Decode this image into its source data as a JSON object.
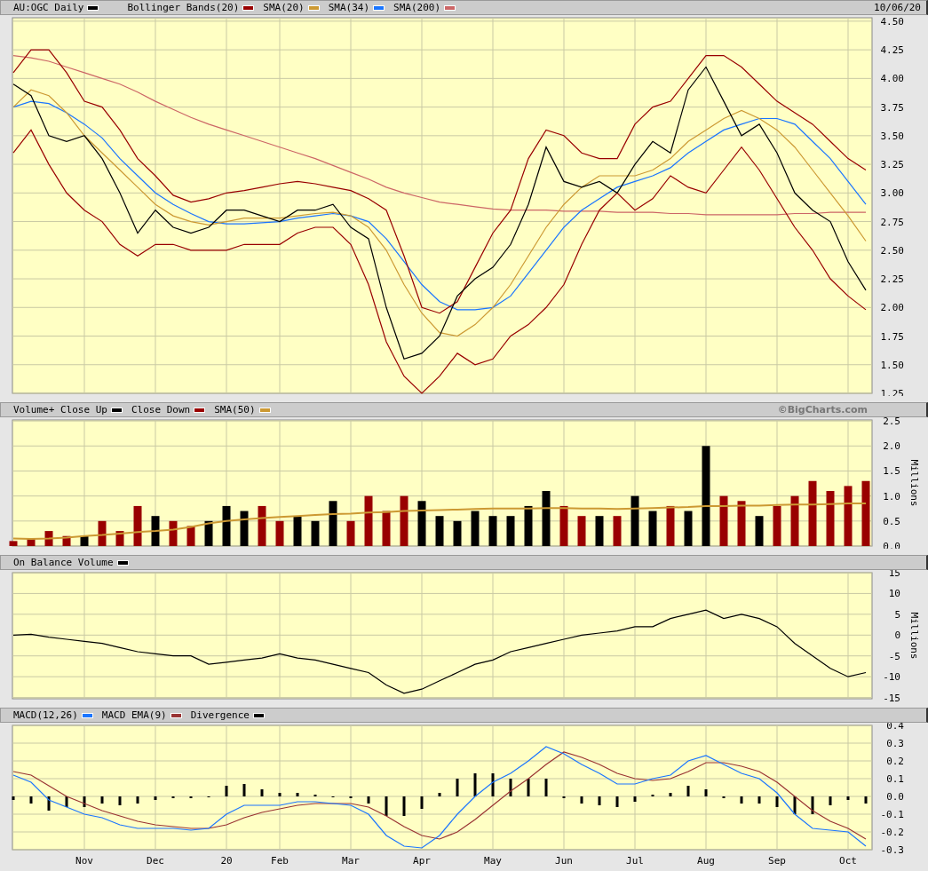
{
  "panels": [
    {
      "date": "10/06/20",
      "chart_data": {
        "type": "line",
        "grid": true,
        "categories": [
          null,
          null,
          null,
          null,
          null,
          null,
          null,
          null,
          null,
          null,
          null,
          null,
          null,
          null,
          null,
          null,
          null,
          null,
          null,
          null,
          null,
          null,
          null,
          null,
          null,
          null,
          null,
          null,
          null,
          null,
          null,
          null,
          null,
          null,
          null,
          null,
          null,
          null,
          null,
          null,
          null,
          null,
          null,
          null,
          null,
          null,
          null,
          null,
          null
        ],
        "ylim": [
          1.25,
          4.53
        ],
        "yticks": [
          {
            "value": 4.5,
            "label": "4.50"
          },
          {
            "value": 4.25,
            "label": "4.25"
          },
          {
            "value": 4,
            "label": "4.00"
          },
          {
            "value": 3.75,
            "label": "3.75"
          },
          {
            "value": 3.5,
            "label": "3.50"
          },
          {
            "value": 3.25,
            "label": "3.25"
          },
          {
            "value": 3,
            "label": "3.00"
          },
          {
            "value": 2.75,
            "label": "2.75"
          },
          {
            "value": 2.5,
            "label": "2.50"
          },
          {
            "value": 2.25,
            "label": "2.25"
          },
          {
            "value": 2,
            "label": "2.00"
          },
          {
            "value": 1.75,
            "label": "1.75"
          },
          {
            "value": 1.5,
            "label": "1.50"
          },
          {
            "value": 1.25,
            "label": "1.25"
          }
        ],
        "series": [
          {
            "name": "AU:OGC Daily",
            "color": "#000000",
            "values": [
              3.95,
              3.85,
              3.5,
              3.45,
              3.5,
              3.3,
              3.0,
              2.65,
              2.85,
              2.7,
              2.65,
              2.7,
              2.85,
              2.85,
              2.8,
              2.75,
              2.85,
              2.85,
              2.9,
              2.7,
              2.6,
              2.0,
              1.55,
              1.6,
              1.75,
              2.1,
              2.25,
              2.35,
              2.55,
              2.9,
              3.4,
              3.1,
              3.05,
              3.1,
              3.0,
              3.25,
              3.45,
              3.35,
              3.9,
              4.1,
              3.8,
              3.5,
              3.6,
              3.35,
              3.0,
              2.85,
              2.75,
              2.4,
              2.15
            ]
          },
          {
            "name": "Bollinger Bands(20)",
            "color": "#990000",
            "values": [
              4.05,
              4.25,
              4.25,
              4.05,
              3.8,
              3.75,
              3.55,
              3.3,
              3.15,
              2.98,
              2.92,
              2.95,
              3.0,
              3.02,
              3.05,
              3.08,
              3.1,
              3.08,
              3.05,
              3.02,
              2.95,
              2.85,
              2.45,
              2.0,
              1.95,
              2.05,
              2.35,
              2.65,
              2.85,
              3.3,
              3.55,
              3.5,
              3.35,
              3.3,
              3.3,
              3.6,
              3.75,
              3.8,
              4.0,
              4.2,
              4.2,
              4.1,
              3.95,
              3.8,
              3.7,
              3.6,
              3.45,
              3.3,
              3.2
            ]
          },
          {
            "color": "#990000",
            "values": [
              3.35,
              3.55,
              3.25,
              3.0,
              2.85,
              2.75,
              2.55,
              2.45,
              2.55,
              2.55,
              2.5,
              2.5,
              2.5,
              2.55,
              2.55,
              2.55,
              2.65,
              2.7,
              2.7,
              2.55,
              2.2,
              1.7,
              1.4,
              1.25,
              1.4,
              1.6,
              1.5,
              1.55,
              1.75,
              1.85,
              2.0,
              2.2,
              2.55,
              2.85,
              3.0,
              2.85,
              2.95,
              3.15,
              3.05,
              3.0,
              3.2,
              3.4,
              3.2,
              2.95,
              2.7,
              2.5,
              2.25,
              2.1,
              1.98
            ]
          },
          {
            "name": "SMA(20)",
            "color": "#cc9933",
            "values": [
              3.75,
              3.9,
              3.85,
              3.7,
              3.5,
              3.35,
              3.2,
              3.05,
              2.9,
              2.8,
              2.75,
              2.72,
              2.75,
              2.78,
              2.78,
              2.78,
              2.8,
              2.82,
              2.83,
              2.8,
              2.7,
              2.5,
              2.2,
              1.95,
              1.78,
              1.75,
              1.85,
              2.0,
              2.2,
              2.45,
              2.7,
              2.9,
              3.05,
              3.15,
              3.15,
              3.15,
              3.2,
              3.3,
              3.45,
              3.55,
              3.65,
              3.72,
              3.65,
              3.55,
              3.4,
              3.2,
              3.0,
              2.8,
              2.58
            ]
          },
          {
            "name": "SMA(34)",
            "color": "#1a75ff",
            "values": [
              3.75,
              3.8,
              3.78,
              3.7,
              3.6,
              3.48,
              3.3,
              3.15,
              3.0,
              2.9,
              2.82,
              2.75,
              2.73,
              2.73,
              2.74,
              2.75,
              2.78,
              2.8,
              2.82,
              2.8,
              2.75,
              2.6,
              2.4,
              2.2,
              2.05,
              1.98,
              1.98,
              2.0,
              2.1,
              2.3,
              2.5,
              2.7,
              2.85,
              2.95,
              3.05,
              3.1,
              3.15,
              3.22,
              3.35,
              3.45,
              3.55,
              3.6,
              3.65,
              3.65,
              3.6,
              3.45,
              3.3,
              3.1,
              2.9
            ]
          },
          {
            "name": "SMA(200)",
            "color": "#cc6666",
            "values": [
              4.2,
              4.18,
              4.15,
              4.1,
              4.05,
              4.0,
              3.95,
              3.88,
              3.8,
              3.73,
              3.66,
              3.6,
              3.55,
              3.5,
              3.45,
              3.4,
              3.35,
              3.3,
              3.24,
              3.18,
              3.12,
              3.05,
              3.0,
              2.96,
              2.92,
              2.9,
              2.88,
              2.86,
              2.85,
              2.85,
              2.85,
              2.84,
              2.84,
              2.84,
              2.83,
              2.83,
              2.83,
              2.82,
              2.82,
              2.81,
              2.81,
              2.81,
              2.81,
              2.81,
              2.82,
              2.82,
              2.83,
              2.83,
              2.83
            ]
          }
        ]
      }
    },
    {
      "credit": "©BigCharts.com",
      "axis_title": "Millions",
      "chart_data": {
        "type": "bar",
        "grid": true,
        "categories": [
          null,
          null,
          null,
          null,
          null,
          null,
          null,
          null,
          null,
          null,
          null,
          null,
          null,
          null,
          null,
          null,
          null,
          null,
          null,
          null,
          null,
          null,
          null,
          null,
          null,
          null,
          null,
          null,
          null,
          null,
          null,
          null,
          null,
          null,
          null,
          null,
          null,
          null,
          null,
          null,
          null,
          null,
          null,
          null,
          null,
          null,
          null,
          null,
          null
        ],
        "ylim": [
          0,
          2.52
        ],
        "yticks": [
          {
            "value": 2.5,
            "label": "2.5"
          },
          {
            "value": 2,
            "label": "2.0"
          },
          {
            "value": 1.5,
            "label": "1.5"
          },
          {
            "value": 1,
            "label": "1.0"
          },
          {
            "value": 0.5,
            "label": "0.5"
          },
          {
            "value": 0,
            "label": "0.0"
          }
        ],
        "series": [
          {
            "name": "Volume+ Close Up",
            "color": "#000000",
            "type": "bar",
            "values": [
              null,
              null,
              null,
              null,
              0.2,
              null,
              null,
              null,
              0.6,
              null,
              null,
              0.5,
              0.8,
              0.7,
              null,
              null,
              0.6,
              0.5,
              0.9,
              null,
              null,
              null,
              null,
              0.9,
              0.6,
              0.5,
              0.7,
              0.6,
              0.6,
              0.8,
              1.1,
              null,
              null,
              0.6,
              null,
              1.0,
              0.7,
              null,
              0.7,
              2.0,
              null,
              null,
              0.6,
              null,
              null,
              null,
              null,
              null,
              null
            ]
          },
          {
            "name": "Close Down",
            "color": "#990000",
            "type": "bar",
            "values": [
              0.1,
              0.15,
              0.3,
              0.2,
              null,
              0.5,
              0.3,
              0.8,
              null,
              0.5,
              0.4,
              null,
              null,
              null,
              0.8,
              0.5,
              null,
              null,
              null,
              0.5,
              1.0,
              0.7,
              1.0,
              null,
              null,
              null,
              null,
              null,
              null,
              null,
              null,
              0.8,
              0.6,
              null,
              0.6,
              null,
              null,
              0.8,
              null,
              null,
              1.0,
              0.9,
              null,
              0.8,
              1.0,
              1.3,
              1.1,
              1.2,
              1.3
            ]
          },
          {
            "name": "SMA(50)",
            "color": "#cc9933",
            "type": "line",
            "values": [
              0.15,
              0.14,
              0.15,
              0.17,
              0.2,
              0.22,
              0.25,
              0.28,
              0.3,
              0.33,
              0.38,
              0.45,
              0.5,
              0.53,
              0.56,
              0.58,
              0.6,
              0.62,
              0.64,
              0.65,
              0.67,
              0.68,
              0.7,
              0.71,
              0.72,
              0.73,
              0.74,
              0.75,
              0.75,
              0.75,
              0.76,
              0.76,
              0.75,
              0.75,
              0.74,
              0.75,
              0.76,
              0.77,
              0.78,
              0.8,
              0.8,
              0.81,
              0.81,
              0.82,
              0.83,
              0.83,
              0.84,
              0.85,
              0.85
            ]
          }
        ]
      }
    },
    {
      "axis_title": "Millions",
      "chart_data": {
        "type": "line",
        "grid": true,
        "categories": [
          null,
          null,
          null,
          null,
          null,
          null,
          null,
          null,
          null,
          null,
          null,
          null,
          null,
          null,
          null,
          null,
          null,
          null,
          null,
          null,
          null,
          null,
          null,
          null,
          null,
          null,
          null,
          null,
          null,
          null,
          null,
          null,
          null,
          null,
          null,
          null,
          null,
          null,
          null,
          null,
          null,
          null,
          null,
          null,
          null,
          null,
          null,
          null,
          null
        ],
        "ylim": [
          -15.3,
          15
        ],
        "yticks": [
          {
            "value": 15,
            "label": "15"
          },
          {
            "value": 10,
            "label": "10"
          },
          {
            "value": 5,
            "label": "5"
          },
          {
            "value": 0,
            "label": "0"
          },
          {
            "value": -5,
            "label": "-5"
          },
          {
            "value": -10,
            "label": "-10"
          },
          {
            "value": -15,
            "label": "-15"
          }
        ],
        "series": [
          {
            "name": "On Balance Volume",
            "color": "#000000",
            "values": [
              0,
              0.2,
              -0.5,
              -1,
              -1.5,
              -2,
              -3,
              -4,
              -4.5,
              -5,
              -5,
              -7,
              -6.5,
              -6,
              -5.5,
              -4.5,
              -5.5,
              -6,
              -7,
              -8,
              -9,
              -12,
              -14,
              -13,
              -11,
              -9,
              -7,
              -6,
              -4,
              -3,
              -2,
              -1,
              0,
              0.5,
              1,
              2,
              2,
              4,
              5,
              6,
              4,
              5,
              4,
              2,
              -2,
              -5,
              -8,
              -10,
              -9
            ]
          }
        ]
      }
    },
    {
      "chart_data": {
        "type": "line",
        "categories": [
          null,
          null,
          null,
          null,
          "Nov",
          null,
          null,
          null,
          "Dec",
          null,
          null,
          null,
          "20",
          null,
          null,
          "Feb",
          null,
          null,
          null,
          "Mar",
          null,
          null,
          null,
          "Apr",
          null,
          null,
          null,
          "May",
          null,
          null,
          null,
          "Jun",
          null,
          null,
          null,
          "Jul",
          null,
          null,
          null,
          "Aug",
          null,
          null,
          null,
          "Sep",
          null,
          null,
          null,
          "Oct",
          null
        ],
        "grid": true,
        "ylim": [
          -0.3,
          0.4
        ],
        "yticks": [
          {
            "value": 0.4,
            "label": "0.4"
          },
          {
            "value": 0.3,
            "label": "0.3"
          },
          {
            "value": 0.2,
            "label": "0.2"
          },
          {
            "value": 0.1,
            "label": "0.1"
          },
          {
            "value": 0,
            "label": "0.0"
          },
          {
            "value": -0.1,
            "label": "-0.1"
          },
          {
            "value": -0.2,
            "label": "-0.2"
          },
          {
            "value": -0.3,
            "label": "-0.3"
          }
        ],
        "series": [
          {
            "name": "MACD(12,26)",
            "color": "#1a75ff",
            "type": "line",
            "values": [
              0.12,
              0.08,
              -0.02,
              -0.06,
              -0.1,
              -0.12,
              -0.16,
              -0.18,
              -0.18,
              -0.18,
              -0.19,
              -0.18,
              -0.1,
              -0.05,
              -0.05,
              -0.05,
              -0.03,
              -0.03,
              -0.04,
              -0.05,
              -0.1,
              -0.22,
              -0.28,
              -0.29,
              -0.22,
              -0.1,
              0,
              0.08,
              0.13,
              0.2,
              0.28,
              0.24,
              0.18,
              0.13,
              0.07,
              0.07,
              0.1,
              0.12,
              0.2,
              0.23,
              0.18,
              0.13,
              0.1,
              0.02,
              -0.1,
              -0.18,
              -0.19,
              -0.2,
              -0.28
            ]
          },
          {
            "name": "MACD EMA(9)",
            "color": "#993333",
            "type": "line",
            "values": [
              0.14,
              0.12,
              0.06,
              0,
              -0.04,
              -0.08,
              -0.11,
              -0.14,
              -0.16,
              -0.17,
              -0.18,
              -0.18,
              -0.16,
              -0.12,
              -0.09,
              -0.07,
              -0.05,
              -0.04,
              -0.04,
              -0.04,
              -0.06,
              -0.11,
              -0.17,
              -0.22,
              -0.24,
              -0.2,
              -0.13,
              -0.05,
              0.03,
              0.1,
              0.18,
              0.25,
              0.22,
              0.18,
              0.13,
              0.1,
              0.09,
              0.1,
              0.14,
              0.19,
              0.19,
              0.17,
              0.14,
              0.08,
              0,
              -0.08,
              -0.14,
              -0.18,
              -0.24
            ]
          },
          {
            "name": "Divergence",
            "color": "#000000",
            "type": "bar",
            "values": [
              -0.02,
              -0.04,
              -0.08,
              -0.06,
              -0.06,
              -0.04,
              -0.05,
              -0.04,
              -0.02,
              -0.01,
              -0.01,
              0,
              0.06,
              0.07,
              0.04,
              0.02,
              0.02,
              0.01,
              0,
              -0.01,
              -0.04,
              -0.11,
              -0.11,
              -0.07,
              0.02,
              0.1,
              0.13,
              0.13,
              0.1,
              0.1,
              0.1,
              -0.01,
              -0.04,
              -0.05,
              -0.06,
              -0.03,
              0.01,
              0.02,
              0.06,
              0.04,
              -0.01,
              -0.04,
              -0.04,
              -0.06,
              -0.1,
              -0.1,
              -0.05,
              -0.02,
              -0.04
            ]
          }
        ]
      }
    }
  ]
}
